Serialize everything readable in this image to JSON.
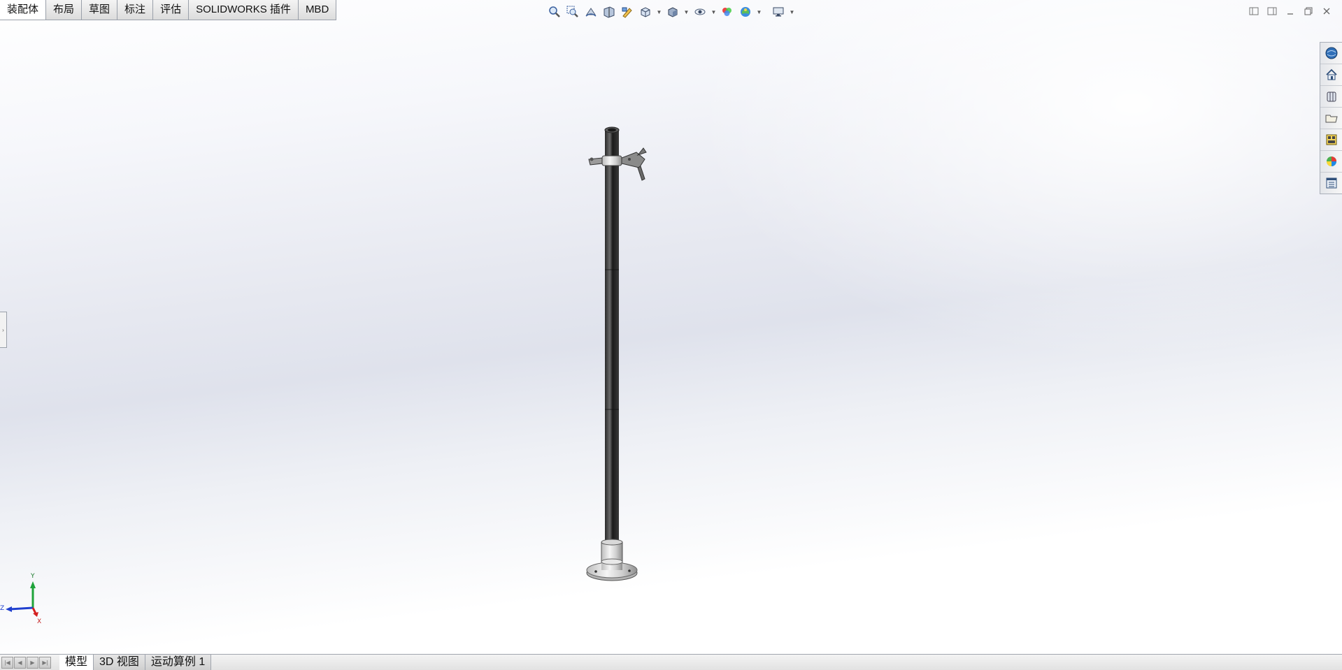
{
  "command_tabs": [
    {
      "label": "装配体",
      "active": true
    },
    {
      "label": "布局",
      "active": false
    },
    {
      "label": "草图",
      "active": false
    },
    {
      "label": "标注",
      "active": false
    },
    {
      "label": "评估",
      "active": false
    },
    {
      "label": "SOLIDWORKS 插件",
      "active": false
    },
    {
      "label": "MBD",
      "active": false
    }
  ],
  "view_toolbar": {
    "icons": [
      "zoom-to-fit-icon",
      "zoom-to-area-icon",
      "previous-view-icon",
      "section-view-icon",
      "dynamic-annotation-icon",
      "view-orientation-icon",
      "display-style-icon",
      "hide-show-items-icon",
      "edit-appearance-icon",
      "apply-scene-icon",
      "view-settings-icon"
    ]
  },
  "window_controls": {
    "icons": [
      "tile-left-icon",
      "tile-right-icon",
      "minimize-icon",
      "restore-icon",
      "close-icon"
    ]
  },
  "task_pane": {
    "icons": [
      "solidworks-resources-icon",
      "home-icon",
      "design-library-icon",
      "file-explorer-icon",
      "view-palette-icon",
      "appearances-scenes-icon",
      "custom-properties-icon"
    ]
  },
  "triad": {
    "y_label": "Y",
    "z_label": "Z",
    "x_label": "X"
  },
  "bottom_tabs": [
    {
      "label": "模型",
      "active": true
    },
    {
      "label": "3D 视图",
      "active": false
    },
    {
      "label": "运动算例 1",
      "active": false
    }
  ],
  "colors": {
    "accent_active_tab": "#ffffff",
    "triad_y": "#1fa33a",
    "triad_z": "#1f3fcf",
    "triad_x": "#d42020"
  }
}
